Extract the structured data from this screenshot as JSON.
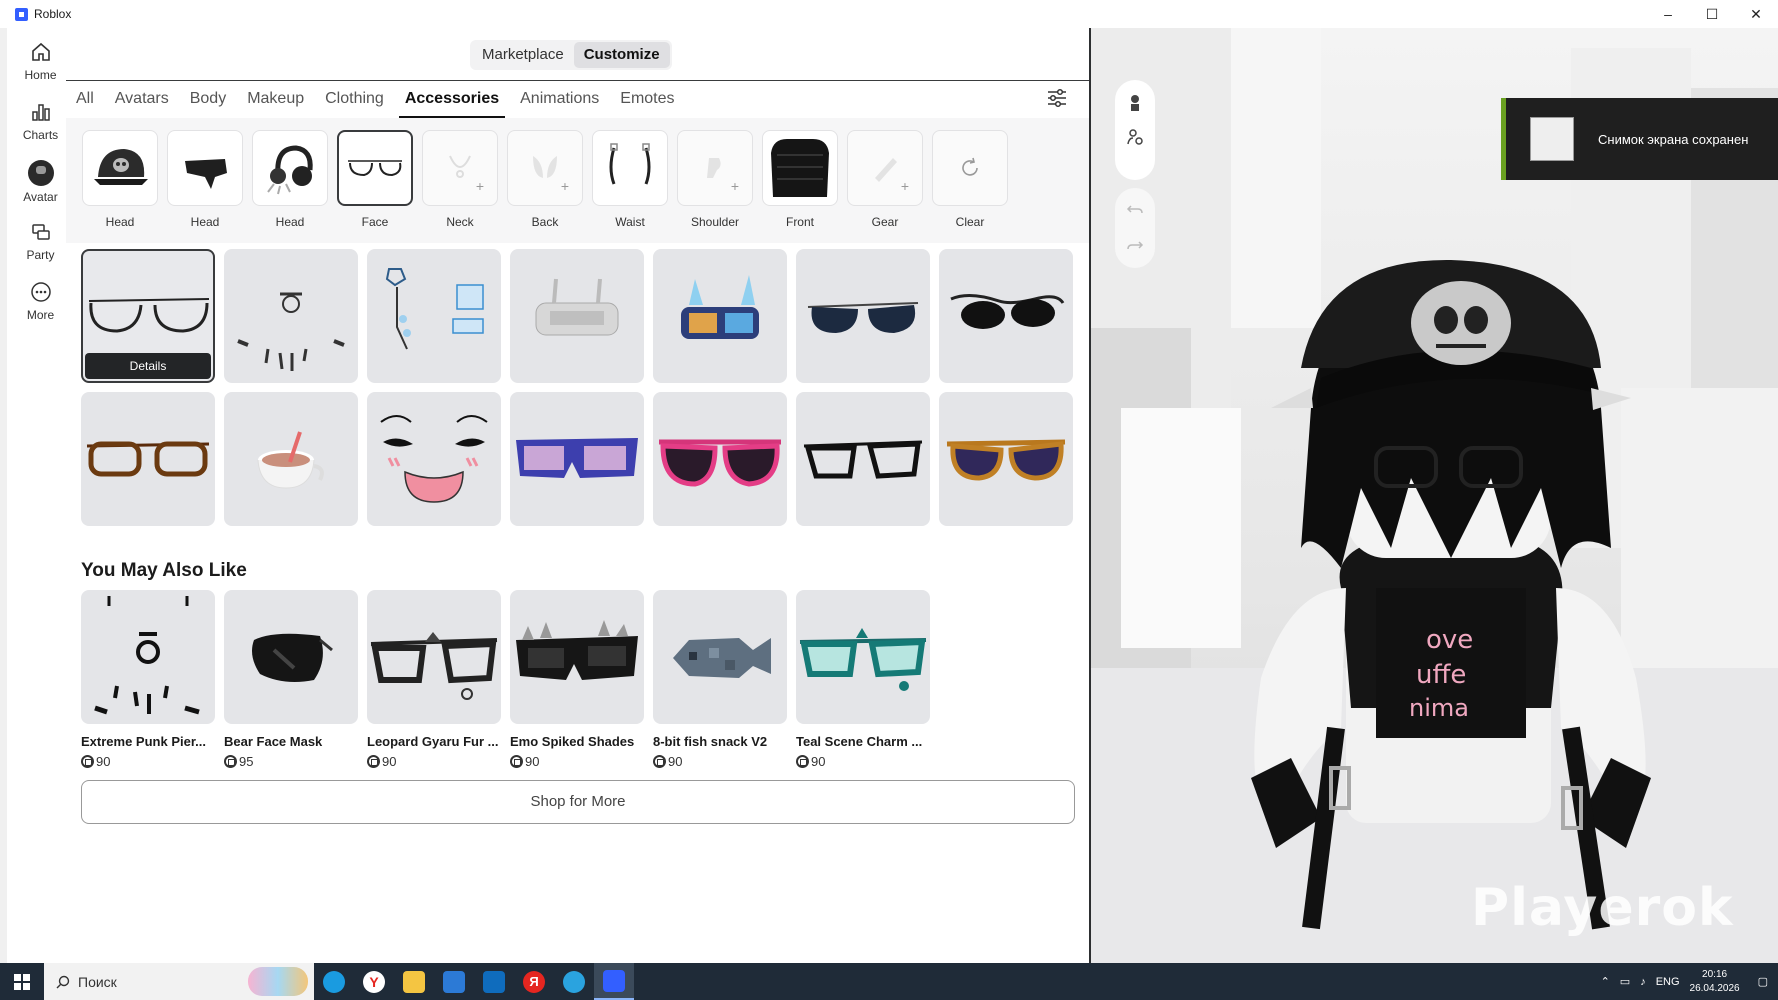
{
  "window": {
    "title": "Roblox",
    "controls": [
      "–",
      "☐",
      "✕"
    ]
  },
  "nav": [
    {
      "label": "Home",
      "icon": "home-icon"
    },
    {
      "label": "Charts",
      "icon": "charts-icon"
    },
    {
      "label": "Avatar",
      "icon": "avatar-icon"
    },
    {
      "label": "Party",
      "icon": "party-icon"
    },
    {
      "label": "More",
      "icon": "more-icon"
    }
  ],
  "segmented": {
    "marketplace": "Marketplace",
    "customize": "Customize"
  },
  "tabs": [
    "All",
    "Avatars",
    "Body",
    "Makeup",
    "Clothing",
    "Accessories",
    "Animations",
    "Emotes"
  ],
  "active_tab": "Accessories",
  "slots": [
    {
      "label": "Head"
    },
    {
      "label": "Head"
    },
    {
      "label": "Head"
    },
    {
      "label": "Face"
    },
    {
      "label": "Neck"
    },
    {
      "label": "Back"
    },
    {
      "label": "Waist"
    },
    {
      "label": "Shoulder"
    },
    {
      "label": "Front"
    },
    {
      "label": "Gear"
    },
    {
      "label": "Clear"
    }
  ],
  "details_label": "Details",
  "section_title": "You May Also Like",
  "recommendations": [
    {
      "name": "Extreme Punk Pier...",
      "price": "90"
    },
    {
      "name": "Bear Face Mask",
      "price": "95"
    },
    {
      "name": "Leopard Gyaru Fur ...",
      "price": "90"
    },
    {
      "name": "Emo Spiked Shades",
      "price": "90"
    },
    {
      "name": "8-bit fish snack V2",
      "price": "90"
    },
    {
      "name": "Teal Scene Charm ...",
      "price": "90"
    }
  ],
  "shop_more": "Shop for More",
  "toast": {
    "message": "Снимок экрана сохранен"
  },
  "watermark": "Playerok",
  "taskbar": {
    "search_placeholder": "Поиск",
    "lang": "ENG",
    "time": "20:16",
    "date": "26.04.2026"
  },
  "colors": {
    "accent": "#335fff",
    "taskbar": "#1f2b38",
    "toast_bar": "#6aa121"
  }
}
